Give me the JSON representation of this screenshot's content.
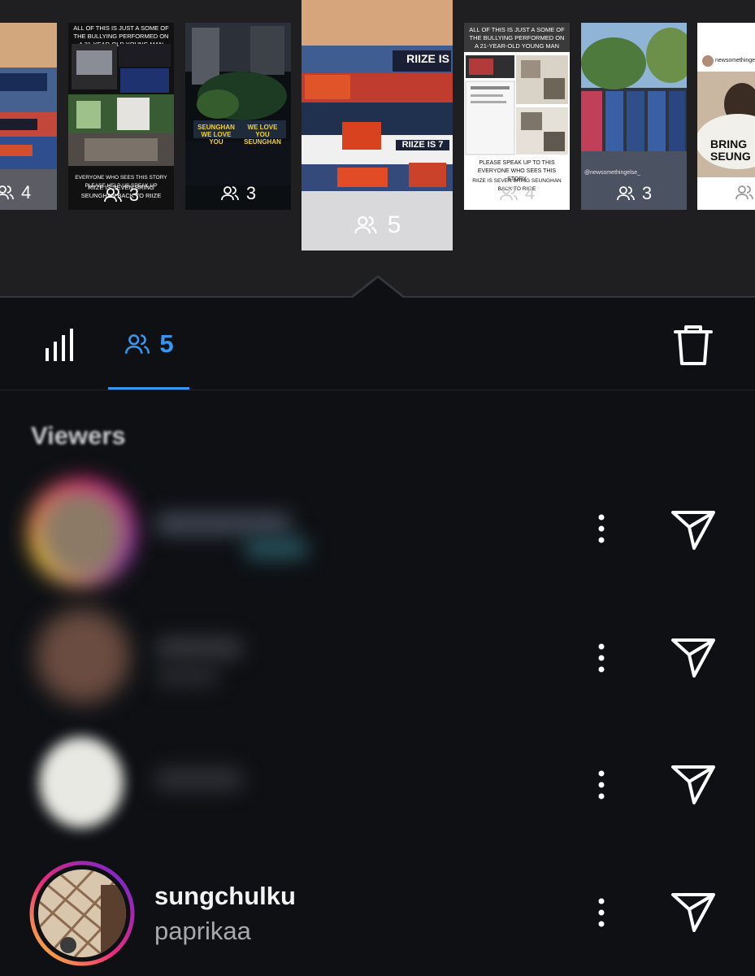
{
  "stories": [
    {
      "id": "t1",
      "viewer_count": "4"
    },
    {
      "id": "t2",
      "viewer_count": "3",
      "caption_top": "ALL OF THIS IS JUST A SOME OF THE BULLYING PERFORMED ON A 21-YEAR-OLD YOUNG MAN",
      "caption_mid": "EVERYONE WHO SEES THIS STORY PLEASE HELP US SPEAK UP",
      "caption_bottom": "RIIZE IS SEVEN BRING SEUNGHAN BACK TO RIIZE"
    },
    {
      "id": "t3",
      "viewer_count": "3",
      "banner_left": "SEUNGHAN WE LOVE YOU",
      "banner_right": "WE LOVE YOU SEUNGHAN"
    },
    {
      "id": "t4",
      "viewer_count": "5",
      "selected": true,
      "text_top": "RIIZE IS",
      "text_mid": "RIIZE IS 7"
    },
    {
      "id": "t5",
      "viewer_count": "4",
      "caption_top": "ALL OF THIS IS JUST A SOME OF THE BULLYING PERFORMED ON A 21-YEAR-OLD YOUNG MAN",
      "caption_mid": "PLEASE SPEAK UP TO THIS EVERYONE WHO SEES THIS STORY",
      "caption_bottom": "RIIZE IS SEVEN BRING SEUNGHAN BACK TO RIIZE"
    },
    {
      "id": "t6",
      "viewer_count": "3",
      "handle": "@newsomethingelse_"
    },
    {
      "id": "t7",
      "viewer_count": "",
      "handle": "newsomethingelse_",
      "text": "BRING SEUNG"
    }
  ],
  "tabs": {
    "insights_icon": "bar-chart-icon",
    "viewers_icon": "people-icon",
    "viewers_count": "5",
    "delete_icon": "trash-icon"
  },
  "viewers": {
    "title": "Viewers",
    "items": [
      {
        "blurred": true
      },
      {
        "blurred": true
      },
      {
        "blurred": true
      },
      {
        "blurred": false,
        "username": "sungchulku",
        "subtitle": "paprikaa"
      }
    ]
  },
  "colors": {
    "background": "#0e1014",
    "strip_background": "#1f1f21",
    "accent": "#3797f0",
    "story_ring_start": "#f9ce34",
    "story_ring_mid": "#ee2a7b",
    "story_ring_end": "#6228d7"
  }
}
